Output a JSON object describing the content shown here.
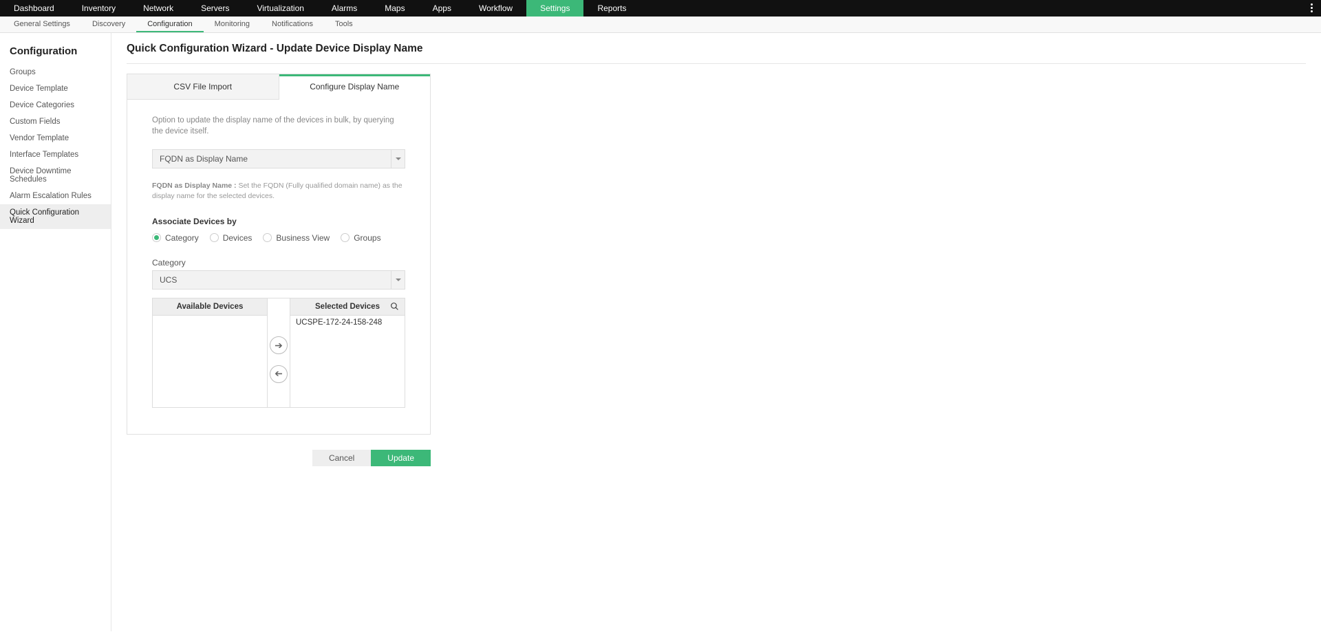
{
  "topNav": {
    "items": [
      "Dashboard",
      "Inventory",
      "Network",
      "Servers",
      "Virtualization",
      "Alarms",
      "Maps",
      "Apps",
      "Workflow",
      "Settings",
      "Reports"
    ],
    "activeIndex": 9
  },
  "subNav": {
    "items": [
      "General Settings",
      "Discovery",
      "Configuration",
      "Monitoring",
      "Notifications",
      "Tools"
    ],
    "activeIndex": 2
  },
  "sidebar": {
    "title": "Configuration",
    "items": [
      "Groups",
      "Device Template",
      "Device Categories",
      "Custom Fields",
      "Vendor Template",
      "Interface Templates",
      "Device Downtime Schedules",
      "Alarm Escalation Rules",
      "Quick Configuration Wizard"
    ],
    "activeIndex": 8
  },
  "page": {
    "title": "Quick Configuration Wizard - Update Device Display Name"
  },
  "wizard": {
    "tabs": {
      "csv": "CSV File Import",
      "configure": "Configure Display Name"
    },
    "description": "Option to update the display name of the devices in bulk, by querying the device itself.",
    "displayNameSelect": "FQDN as Display Name",
    "hintLabel": "FQDN as Display Name :",
    "hintText": " Set the FQDN (Fully qualified domain name) as the display name for the selected devices.",
    "associateLabel": "Associate Devices by",
    "radios": {
      "category": "Category",
      "devices": "Devices",
      "businessView": "Business View",
      "groups": "Groups"
    },
    "categoryLabel": "Category",
    "categorySelect": "UCS",
    "transfer": {
      "availableHeader": "Available Devices",
      "selectedHeader": "Selected Devices",
      "available": [],
      "selected": [
        "UCSPE-172-24-158-248"
      ]
    }
  },
  "actions": {
    "cancel": "Cancel",
    "update": "Update"
  }
}
